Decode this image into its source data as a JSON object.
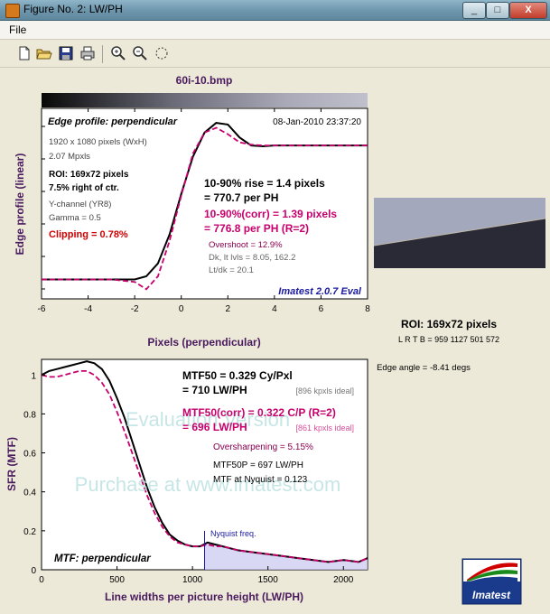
{
  "window": {
    "title": "Figure No. 2: LW/PH",
    "minimize": "_",
    "maximize": "□",
    "close": "X"
  },
  "menu": {
    "file": "File"
  },
  "toolbar": {
    "icons": [
      "new-file-icon",
      "open-folder-icon",
      "save-icon",
      "print-icon",
      "zoom-in-icon",
      "zoom-out-icon",
      "rotate-icon"
    ]
  },
  "figure": {
    "filename": "60i-10.bmp",
    "roi_title": "ROI: 169x72 pixels",
    "roi_lrtb": "L R  T B = 959 1127  501 572",
    "edge_angle": "Edge angle = -8.41 degs",
    "logo_text": "Imatest"
  },
  "chart_data": [
    {
      "type": "line",
      "title": "Edge profile: perpendicular",
      "timestamp": "08-Jan-2010 23:37:20",
      "xlabel": "Pixels (perpendicular)",
      "ylabel": "Edge profile (linear)",
      "xlim": [
        -6,
        8
      ],
      "xticks": [
        "-6",
        "-4",
        "-2",
        "0",
        "2",
        "4",
        "6",
        "8"
      ],
      "annotations": {
        "info1": "1920 x 1080 pixels (WxH)",
        "info2": "2.07 Mpxls",
        "roi": "ROI: 169x72 pixels",
        "offset": "7.5% right of ctr.",
        "channel": "Y-channel  (YR8)",
        "gamma": "Gamma = 0.5",
        "clipping": "Clipping =   0.78%",
        "rise1": "10-90% rise = 1.4 pixels",
        "rise2": "= 770.7 per PH",
        "rise3": "10-90%(corr) = 1.39 pixels",
        "rise4": "= 776.8 per PH  (R=2)",
        "overshoot": "Overshoot = 12.9%",
        "dk": "Dk, lt lvls = 8.05, 162.2",
        "ltdk": "Lt/dk = 20.1",
        "version": "Imatest 2.0.7 Eval"
      },
      "series": [
        {
          "name": "Edge profile",
          "color": "#000000",
          "x": [
            -6,
            -5,
            -4,
            -3,
            -2,
            -1.5,
            -1,
            -0.5,
            0,
            0.5,
            1,
            1.5,
            2,
            2.5,
            3,
            3.5,
            4,
            5,
            6,
            7,
            8
          ],
          "y": [
            0.02,
            0.02,
            0.02,
            0.02,
            0.02,
            0.04,
            0.12,
            0.3,
            0.55,
            0.78,
            0.93,
            0.99,
            0.98,
            0.9,
            0.85,
            0.845,
            0.85,
            0.85,
            0.85,
            0.85,
            0.85
          ]
        },
        {
          "name": "Edge profile (corr)",
          "color": "#c8006e",
          "x": [
            -6,
            -5,
            -4,
            -3,
            -2,
            -1.5,
            -1,
            -0.5,
            0,
            0.5,
            1,
            1.5,
            2,
            2.5,
            3,
            3.5,
            4,
            5,
            6,
            7,
            8
          ],
          "y": [
            0.02,
            0.02,
            0.02,
            0.02,
            0.005,
            -0.04,
            0.04,
            0.26,
            0.54,
            0.8,
            0.93,
            0.96,
            0.92,
            0.87,
            0.855,
            0.85,
            0.85,
            0.85,
            0.85,
            0.85,
            0.85
          ]
        }
      ]
    },
    {
      "type": "line",
      "title": "MTF: perpendicular",
      "xlabel": "Line widths per picture height (LW/PH)",
      "ylabel": "SFR (MTF)",
      "xlim": [
        0,
        2160
      ],
      "ylim": [
        0,
        1.08
      ],
      "xticks": [
        "0",
        "500",
        "1000",
        "1500",
        "2000"
      ],
      "yticks": [
        "0",
        "0.2",
        "0.4",
        "0.6",
        "0.8",
        "1"
      ],
      "nyquist_x": 1080,
      "nyquist_label": "Nyquist freq.",
      "watermark1": "Evaluation Version",
      "watermark2": "Purchase at www.imatest.com",
      "annotations": {
        "mtf50": "MTF50 = 0.329 Cy/Pxl",
        "mtf50b": "= 710 LW/PH",
        "ideal1": "[896 kpxls ideal]",
        "mtf50c": "MTF50(corr) = 0.322 C/P  (R=2)",
        "mtf50d": "= 696 LW/PH",
        "ideal2": "[861 kpxls ideal]",
        "oversharp": "Oversharpening = 5.15%",
        "mtf50p": "MTF50P = 697 LW/PH",
        "nyq": "MTF at Nyquist = 0.123"
      },
      "series": [
        {
          "name": "MTF",
          "color": "#000000",
          "x": [
            0,
            50,
            100,
            150,
            200,
            250,
            300,
            350,
            400,
            450,
            500,
            550,
            600,
            650,
            700,
            750,
            800,
            850,
            900,
            950,
            1000,
            1050,
            1100,
            1150,
            1200,
            1300,
            1400,
            1500,
            1600,
            1700,
            1800,
            1900,
            2000,
            2100,
            2160
          ],
          "y": [
            1.0,
            1.02,
            1.03,
            1.04,
            1.05,
            1.06,
            1.07,
            1.06,
            1.03,
            0.97,
            0.88,
            0.78,
            0.66,
            0.54,
            0.42,
            0.32,
            0.24,
            0.18,
            0.15,
            0.13,
            0.12,
            0.12,
            0.14,
            0.13,
            0.12,
            0.1,
            0.09,
            0.08,
            0.07,
            0.06,
            0.05,
            0.04,
            0.05,
            0.04,
            0.06
          ]
        },
        {
          "name": "MTF (corr)",
          "color": "#c8006e",
          "x": [
            0,
            50,
            100,
            150,
            200,
            250,
            300,
            350,
            400,
            450,
            500,
            550,
            600,
            650,
            700,
            750,
            800,
            850,
            900,
            950,
            1000,
            1050,
            1100,
            1150,
            1200,
            1300,
            1400,
            1500,
            1600,
            1700,
            1800,
            1900,
            2000,
            2100,
            2160
          ],
          "y": [
            1.0,
            0.99,
            0.99,
            1.0,
            1.01,
            1.02,
            1.02,
            1.0,
            0.96,
            0.9,
            0.81,
            0.71,
            0.6,
            0.49,
            0.38,
            0.29,
            0.22,
            0.17,
            0.14,
            0.13,
            0.12,
            0.12,
            0.13,
            0.12,
            0.12,
            0.1,
            0.09,
            0.08,
            0.07,
            0.06,
            0.05,
            0.04,
            0.05,
            0.04,
            0.06
          ]
        }
      ]
    }
  ]
}
